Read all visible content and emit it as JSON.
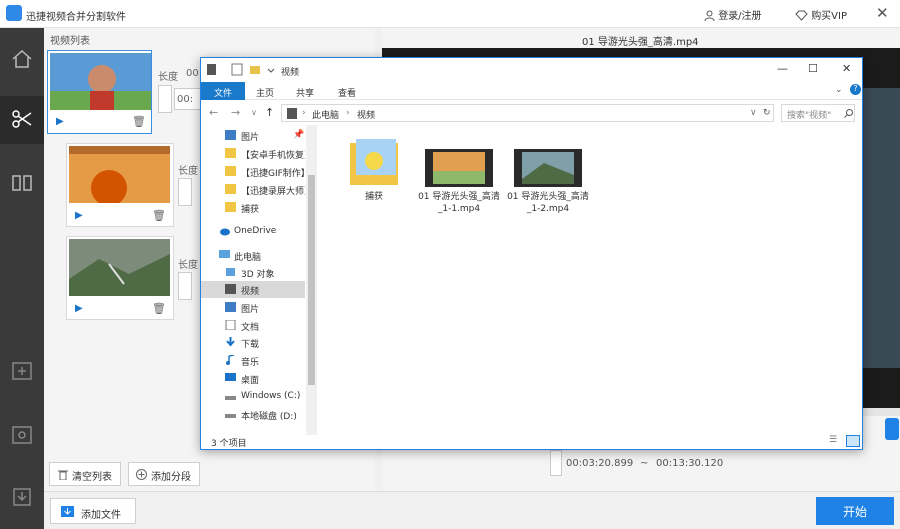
{
  "app": {
    "title": "迅捷视频合并分割软件",
    "login_label": "登录/注册",
    "buy_label": "购买VIP",
    "close_glyph": "✕"
  },
  "left_panel": {
    "header": "视频列表",
    "clips": [
      {
        "length_label": "长度",
        "length_value": "00",
        "time_value": "00:",
        "play_icon": "▶",
        "delete_icon": "🗑"
      },
      {
        "length_label": "长度",
        "play_icon": "▶",
        "delete_icon": "🗑"
      },
      {
        "length_label": "长度",
        "play_icon": "▶",
        "delete_icon": "🗑"
      }
    ],
    "clear_label": "清空列表",
    "add_segment_label": "添加分段"
  },
  "right_panel": {
    "video_title": "01 导游光头强_高清.mp4",
    "start_time": "00:03:20.899",
    "separator": "~",
    "end_time": "00:13:30.120"
  },
  "bottom": {
    "add_file_label": "添加文件",
    "start_label": "开始"
  },
  "explorer": {
    "title": "视频",
    "ribbon_tabs": [
      "文件",
      "主页",
      "共享",
      "查看"
    ],
    "address": [
      "此电脑",
      "视频"
    ],
    "search_placeholder": "搜索\"视频\"",
    "nav_items": [
      {
        "label": "图片",
        "icon": "pictures-icon"
      },
      {
        "label": "【安卓手机恢复】",
        "icon": "folder-icon"
      },
      {
        "label": "【迅捷GIF制作】",
        "icon": "folder-icon"
      },
      {
        "label": "【迅捷录屏大师】",
        "icon": "folder-icon"
      },
      {
        "label": "捕获",
        "icon": "folder-icon"
      },
      {
        "label": "OneDrive",
        "icon": "cloud-icon"
      },
      {
        "label": "此电脑",
        "icon": "computer-icon"
      },
      {
        "label": "3D 对象",
        "icon": "cube-icon"
      },
      {
        "label": "视频",
        "icon": "video-icon"
      },
      {
        "label": "图片",
        "icon": "pictures-icon"
      },
      {
        "label": "文档",
        "icon": "documents-icon"
      },
      {
        "label": "下载",
        "icon": "download-icon"
      },
      {
        "label": "音乐",
        "icon": "music-icon"
      },
      {
        "label": "桌面",
        "icon": "desktop-icon"
      },
      {
        "label": "Windows (C:)",
        "icon": "drive-icon"
      },
      {
        "label": "本地磁盘 (D:)",
        "icon": "drive-icon"
      }
    ],
    "files": [
      {
        "name": "捕获",
        "type": "folder"
      },
      {
        "name": "01 导游光头强_高清_1-1.mp4",
        "type": "video"
      },
      {
        "name": "01 导游光头强_高清_1-2.mp4",
        "type": "video"
      }
    ],
    "status": "3 个项目"
  },
  "colors": {
    "accent": "#1e82e6",
    "sidebar": "#3a3a3a"
  }
}
